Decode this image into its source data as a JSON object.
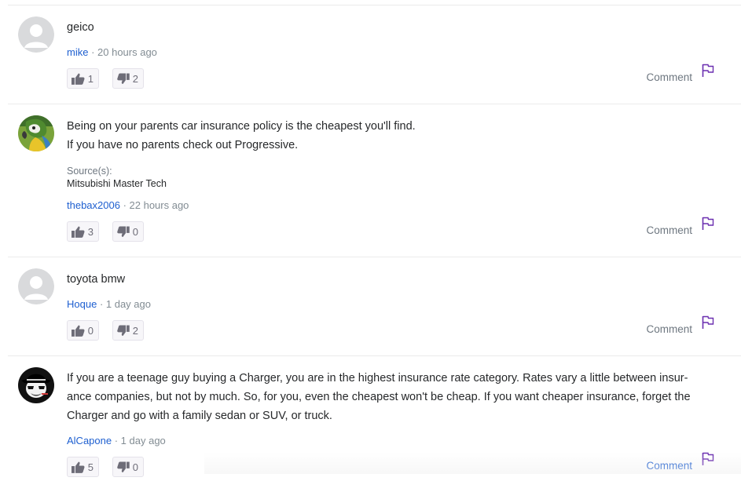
{
  "answers": [
    {
      "text": "geico",
      "author": "mike",
      "time": "· 20 hours ago",
      "upvotes": "1",
      "downvotes": "2",
      "comment_label": "Comment"
    },
    {
      "text": "Being on your parents car insurance policy is the cheapest you'll find.\nIf you have no parents check out Progressive.",
      "source_label": "Source(s):",
      "source": "Mitsubishi Master Tech",
      "author": "thebax2006",
      "time": "· 22 hours ago",
      "upvotes": "3",
      "downvotes": "0",
      "comment_label": "Comment"
    },
    {
      "text": "toyota bmw",
      "author": "Hoque",
      "time": "· 1 day ago",
      "upvotes": "0",
      "downvotes": "2",
      "comment_label": "Comment"
    },
    {
      "text": "If you are a teenage guy buying a Charger, you are in the highest insurance rate category. Rates vary a little between insur-\nance companies, but not by much. So, for you, even the cheapest won't be cheap. If you want cheaper insurance, forget the\nCharger and go with a family sedan or SUV, or truck.",
      "author": "AlCapone",
      "time": "· 1 day ago",
      "upvotes": "5",
      "downvotes": "0",
      "comment_label": "Comment"
    }
  ],
  "colors": {
    "link": "#1e5fd0",
    "flag": "#6b2fb0",
    "vote_icon": "#6e6d78"
  },
  "icons": {
    "upvote": "thumbs-up-icon",
    "downvote": "thumbs-down-icon",
    "report": "flag-icon"
  }
}
